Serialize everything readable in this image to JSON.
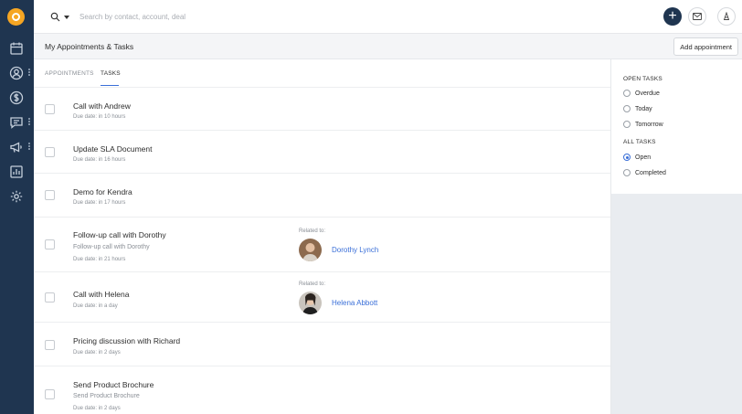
{
  "search": {
    "placeholder": "Search by contact, account, deal"
  },
  "header": {
    "title": "My Appointments & Tasks",
    "add_label": "Add appointment"
  },
  "tabs": [
    {
      "label": "APPOINTMENTS",
      "active": false
    },
    {
      "label": "TASKS",
      "active": true
    }
  ],
  "tasks": [
    {
      "title": "Call with Andrew",
      "subtitle": "",
      "due": "Due date: in 10 hours"
    },
    {
      "title": "Update SLA Document",
      "subtitle": "",
      "due": "Due date: in 16 hours"
    },
    {
      "title": "Demo for Kendra",
      "subtitle": "",
      "due": "Due date: in 17 hours"
    },
    {
      "title": "Follow-up call with Dorothy",
      "subtitle": "Follow-up call with Dorothy",
      "due": "Due date: in 21 hours",
      "related_label": "Related to:",
      "related_name": "Dorothy Lynch"
    },
    {
      "title": "Call with Helena",
      "subtitle": "",
      "due": "Due date: in a day",
      "related_label": "Related to:",
      "related_name": "Helena Abbott"
    },
    {
      "title": "Pricing discussion with Richard",
      "subtitle": "",
      "due": "Due date: in 2 days"
    },
    {
      "title": "Send Product Brochure",
      "subtitle": "Send Product Brochure",
      "due": "Due date: in 2 days"
    }
  ],
  "filters": {
    "open_heading": "OPEN TASKS",
    "open_options": [
      {
        "label": "Overdue",
        "checked": false
      },
      {
        "label": "Today",
        "checked": false
      },
      {
        "label": "Tomorrow",
        "checked": false
      }
    ],
    "all_heading": "ALL TASKS",
    "all_options": [
      {
        "label": "Open",
        "checked": true
      },
      {
        "label": "Completed",
        "checked": false
      }
    ]
  },
  "icons": {
    "sidebar": [
      "calendar-icon",
      "contact-icon",
      "dollar-icon",
      "chat-icon",
      "megaphone-icon",
      "report-icon",
      "settings-icon"
    ],
    "top": [
      "search-icon",
      "plus-icon",
      "mail-icon",
      "user-icon"
    ]
  },
  "colors": {
    "sidebar": "#1f3550",
    "accent": "#3a6fd8",
    "logo": "#f6a623"
  }
}
